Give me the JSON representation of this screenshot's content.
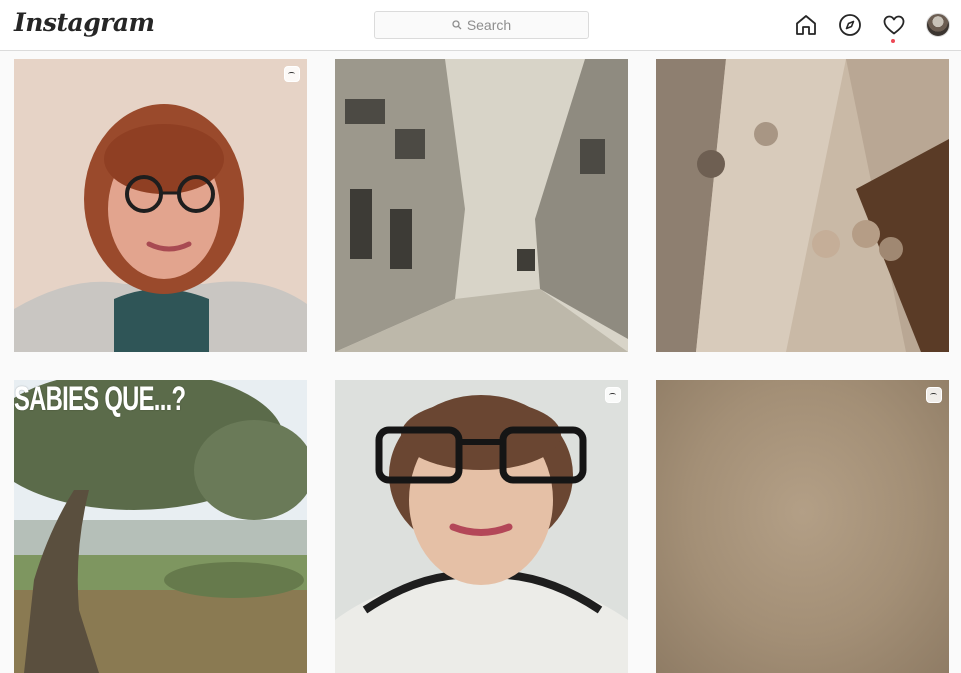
{
  "app": {
    "logo": "Instagram"
  },
  "search": {
    "placeholder": "Search"
  },
  "nav": {
    "icons": [
      "home-icon",
      "explore-icon",
      "activity-heart-icon",
      "profile-avatar"
    ]
  },
  "posts": [
    {
      "type": "reel",
      "subject": "woman-with-glasses-portrait"
    },
    {
      "type": "photo",
      "subject": "old-street-photograph"
    },
    {
      "type": "photo",
      "subject": "stone-church-portal-carvings"
    },
    {
      "type": "photo",
      "subject": "olive-tree-landscape",
      "overlay_text": "SABIES QUE...?"
    },
    {
      "type": "reel",
      "subject": "woman-short-hair-glasses"
    },
    {
      "type": "reel",
      "subject": "beige-blank-frame"
    }
  ],
  "colors": {
    "accent_dot": "#ed4956",
    "border": "#dbdbdb",
    "text": "#262626"
  }
}
